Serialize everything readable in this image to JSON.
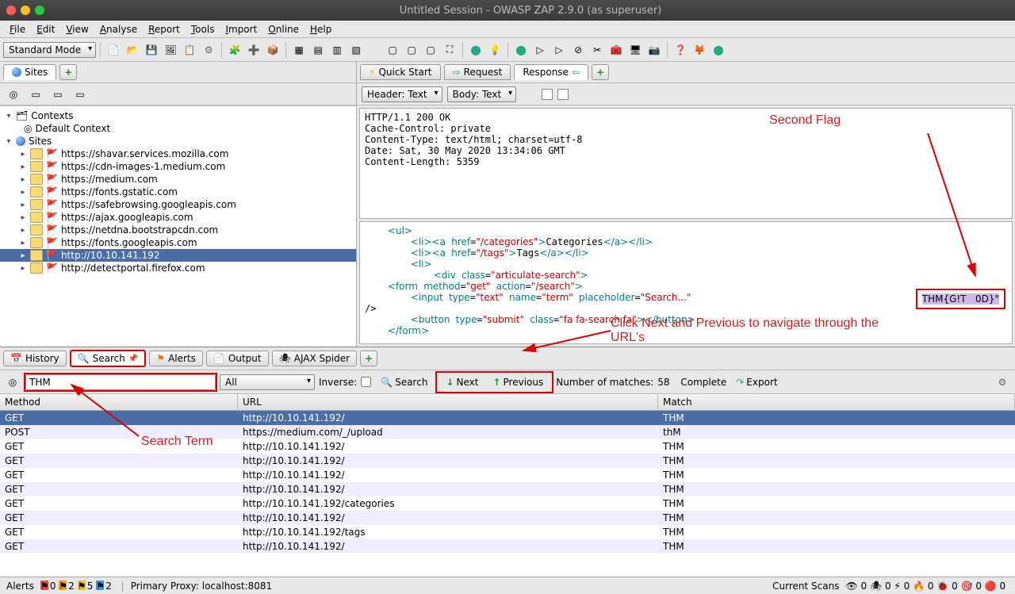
{
  "title": "Untitled Session - OWASP ZAP 2.9.0 (as superuser)",
  "menu": [
    "File",
    "Edit",
    "View",
    "Analyse",
    "Report",
    "Tools",
    "Import",
    "Online",
    "Help"
  ],
  "mode": "Standard Mode",
  "left_tab": "Sites",
  "sites_tree": {
    "contexts": "Contexts",
    "default_context": "Default Context",
    "sites_root": "Sites",
    "hosts": [
      "https://shavar.services.mozilla.com",
      "https://cdn-images-1.medium.com",
      "https://medium.com",
      "https://fonts.gstatic.com",
      "https://safebrowsing.googleapis.com",
      "https://ajax.googleapis.com",
      "https://netdna.bootstrapcdn.com",
      "https://fonts.googleapis.com",
      "http://10.10.141.192",
      "http://detectportal.firefox.com"
    ]
  },
  "right_tabs": {
    "quick": "Quick Start",
    "request": "Request",
    "response": "Response"
  },
  "view_combos": {
    "header": "Header: Text",
    "body": "Body: Text"
  },
  "response_header": "HTTP/1.1 200 OK\nCache-Control: private\nContent-Type: text/html; charset=utf-8\nDate: Sat, 30 May 2020 13:34:06 GMT\nContent-Length: 5359",
  "flag": "THM{G!T   0D}\"",
  "bottom_tabs": {
    "history": "History",
    "search": "Search",
    "alerts": "Alerts",
    "output": "Output",
    "ajax": "AJAX Spider"
  },
  "search": {
    "term": "THM",
    "scope": "All",
    "inverse_label": "Inverse:",
    "search_btn": "Search",
    "next": "Next",
    "prev": "Previous",
    "matches_label": "Number of matches:",
    "matches": "58",
    "complete": "Complete",
    "export": "Export"
  },
  "results_header": {
    "method": "Method",
    "url": "URL",
    "match": "Match"
  },
  "results": [
    {
      "m": "GET",
      "u": "http://10.10.141.192/",
      "x": "THM",
      "sel": true
    },
    {
      "m": "POST",
      "u": "https://medium.com/_/upload",
      "x": "thM"
    },
    {
      "m": "GET",
      "u": "http://10.10.141.192/",
      "x": "THM"
    },
    {
      "m": "GET",
      "u": "http://10.10.141.192/",
      "x": "THM"
    },
    {
      "m": "GET",
      "u": "http://10.10.141.192/",
      "x": "THM"
    },
    {
      "m": "GET",
      "u": "http://10.10.141.192/",
      "x": "THM"
    },
    {
      "m": "GET",
      "u": "http://10.10.141.192/categories",
      "x": "THM"
    },
    {
      "m": "GET",
      "u": "http://10.10.141.192/",
      "x": "THM"
    },
    {
      "m": "GET",
      "u": "http://10.10.141.192/tags",
      "x": "THM"
    },
    {
      "m": "GET",
      "u": "http://10.10.141.192/",
      "x": "THM"
    }
  ],
  "status": {
    "alerts_label": "Alerts",
    "flags": [
      {
        "c": "#e74c3c",
        "n": "0"
      },
      {
        "c": "#f39c12",
        "n": "2"
      },
      {
        "c": "#f1c40f",
        "n": "5"
      },
      {
        "c": "#3498db",
        "n": "2"
      }
    ],
    "proxy": "Primary Proxy: localhost:8081",
    "scans": "Current Scans",
    "scan_vals": [
      "0",
      "0",
      "0",
      "0",
      "0",
      "0",
      "0"
    ]
  },
  "annotations": {
    "second_flag": "Second Flag",
    "nav_note": "Click Next and Previous to navigate through the URL's",
    "search_term": "Search Term"
  }
}
